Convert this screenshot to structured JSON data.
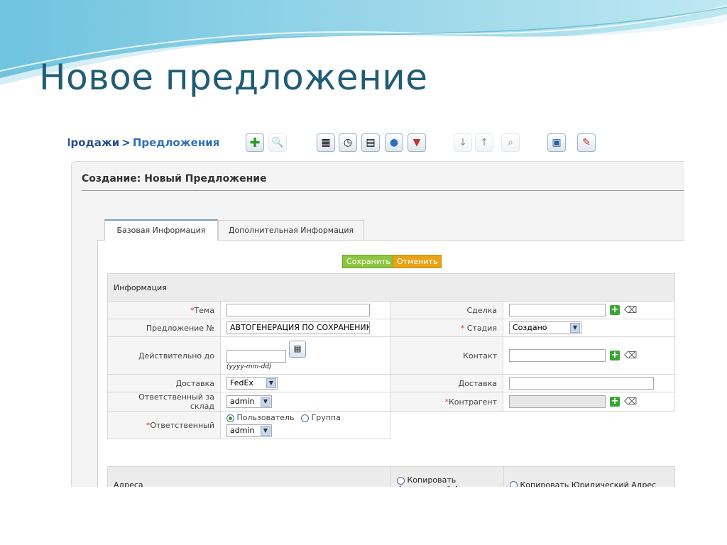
{
  "slide": {
    "title": "Новое предложение"
  },
  "breadcrumb": {
    "module": "Продажи",
    "separator": ">",
    "current": "Предложения"
  },
  "toolbar": {
    "icons": [
      "add-icon",
      "search-icon",
      "calendar-icon",
      "clock-icon",
      "calculator-icon",
      "chat-icon",
      "import-icon",
      "arrow-down-icon",
      "arrow-up-icon",
      "find-duplicates-icon",
      "computer-icon",
      "settings-icon"
    ]
  },
  "form": {
    "heading": "Создание: Новый Предложение",
    "tabs": [
      {
        "label": "Базовая Информация",
        "active": true
      },
      {
        "label": "Дополнительная Информация",
        "active": false
      }
    ],
    "save_label": "Сохранить",
    "cancel_label": "Отменить",
    "section_title": "Информация",
    "fields": {
      "subject_label": "Тема",
      "subject_value": "",
      "deal_label": "Сделка",
      "deal_value": "",
      "quote_no_label": "Предложение №",
      "quote_no_value": "АВТОГЕНЕРАЦИЯ ПО СОХРАНЕНИЮ",
      "stage_label": "Стадия",
      "stage_value": "Создано",
      "valid_until_label": "Действительно до",
      "valid_until_value": "",
      "date_hint": "(yyyy-mm-dd)",
      "contact_label": "Контакт",
      "contact_value": "",
      "shipping_label": "Доставка",
      "shipping_value": "FedEx",
      "shipping2_label": "Доставка",
      "shipping2_value": "",
      "warehouse_owner_label": "Ответственный за склад",
      "warehouse_owner_value": "admin",
      "account_label": "Контрагент",
      "account_value": "",
      "owner_label": "Ответственный",
      "owner_user_label": "Пользователь",
      "owner_group_label": "Группа",
      "owner_value": "admin"
    },
    "address": {
      "title": "Адреса",
      "copy_actual": "Копировать Фактический Адрес",
      "copy_legal": "Копировать Юридический Адрес"
    }
  },
  "colors": {
    "title": "#1f5c75",
    "save": "#8cc63f",
    "cancel": "#e8a317",
    "required": "#e03030"
  }
}
